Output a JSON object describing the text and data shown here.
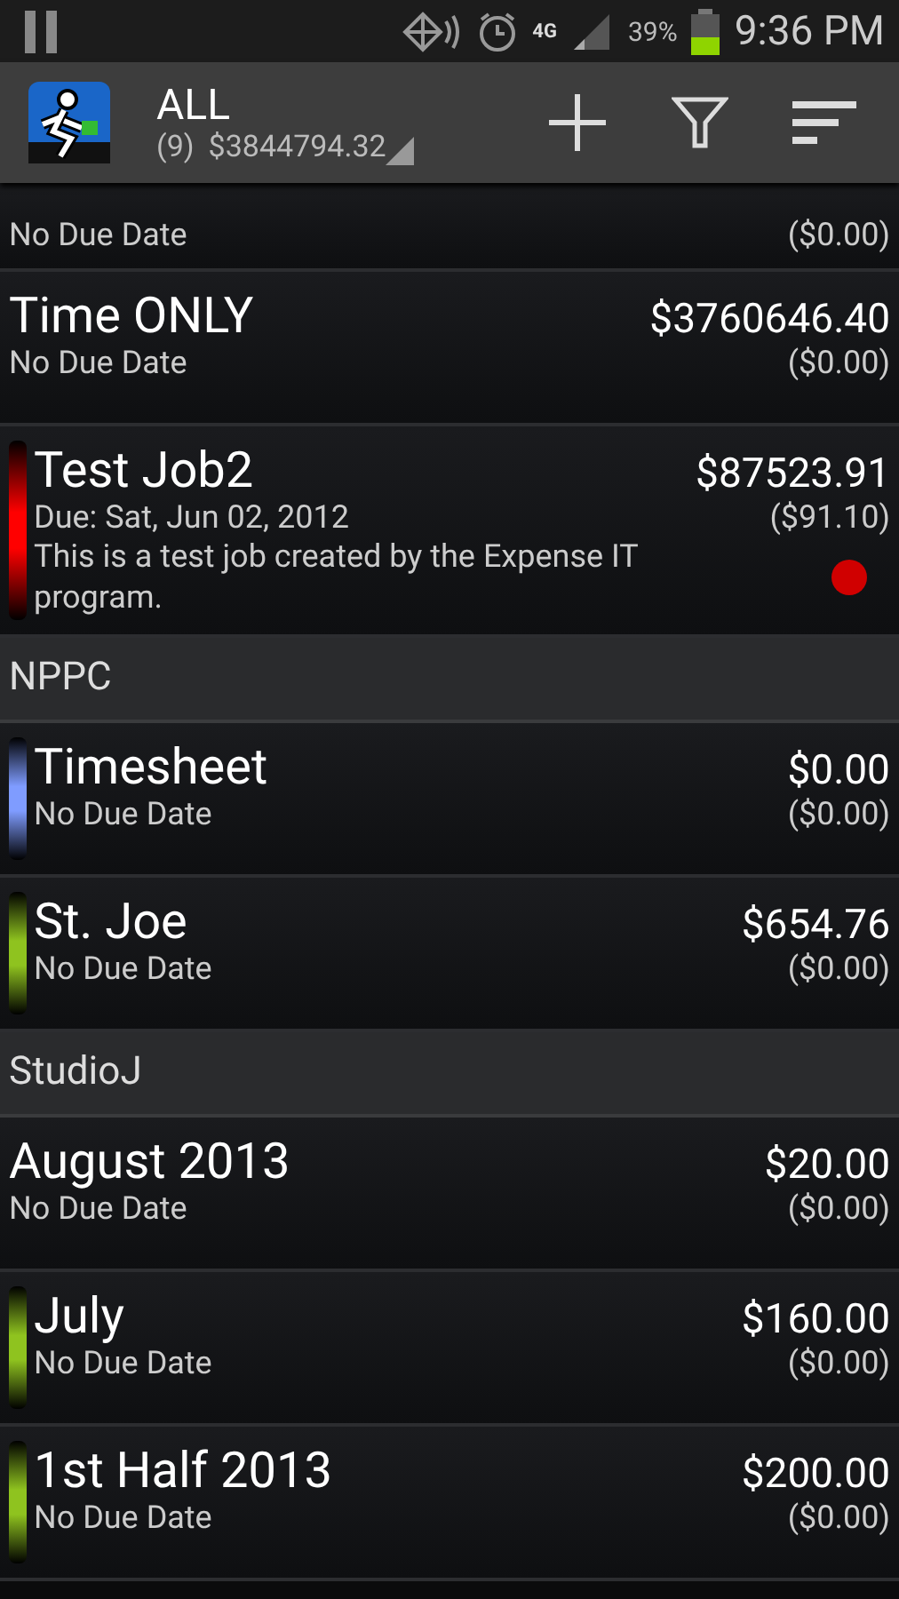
{
  "status_bar": {
    "battery": "39%",
    "time": "9:36 PM",
    "network": "4G"
  },
  "action_bar": {
    "title": "ALL",
    "count": "(9)",
    "total": "$3844794.32"
  },
  "items": [
    {
      "kind": "job",
      "due": "No Due Date",
      "balance": "($0.00)"
    },
    {
      "kind": "job",
      "title": "Time ONLY",
      "amount": "$3760646.40",
      "due": "No Due Date",
      "balance": "($0.00)"
    },
    {
      "kind": "job",
      "title": "Test Job2",
      "amount": "$87523.91",
      "due": "Due: Sat, Jun 02, 2012",
      "note": "This is a test job created by the Expense IT program.",
      "balance": "($91.10)",
      "color": "#ff0000",
      "alert": true
    },
    {
      "kind": "header",
      "label": "NPPC"
    },
    {
      "kind": "job",
      "title": "Timesheet",
      "amount": "$0.00",
      "due": "No Due Date",
      "balance": "($0.00)",
      "color": "#7f9cff"
    },
    {
      "kind": "job",
      "title": "St. Joe",
      "amount": "$654.76",
      "due": "No Due Date",
      "balance": "($0.00)",
      "color": "#8fc31f"
    },
    {
      "kind": "header",
      "label": "StudioJ"
    },
    {
      "kind": "job",
      "title": "August 2013",
      "amount": "$20.00",
      "due": "No Due Date",
      "balance": "($0.00)"
    },
    {
      "kind": "job",
      "title": "July",
      "amount": "$160.00",
      "due": "No Due Date",
      "balance": "($0.00)",
      "color": "#8fc31f"
    },
    {
      "kind": "job",
      "title": "1st Half 2013",
      "amount": "$200.00",
      "due": "No Due Date",
      "balance": "($0.00)",
      "color": "#8fc31f"
    }
  ]
}
